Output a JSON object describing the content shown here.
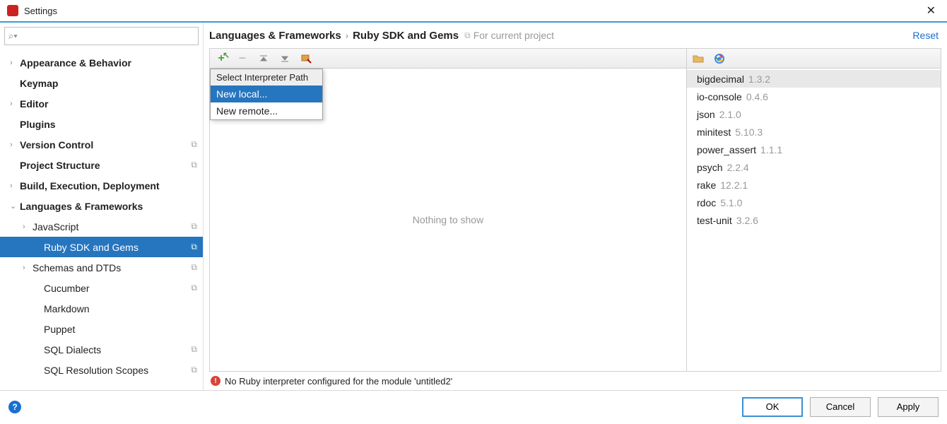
{
  "window": {
    "title": "Settings"
  },
  "sidebar": {
    "search_placeholder": "",
    "items": [
      {
        "label": "Appearance & Behavior",
        "bold": true,
        "arrow": "collapsed",
        "indent": 0
      },
      {
        "label": "Keymap",
        "bold": true,
        "arrow": "",
        "indent": 0
      },
      {
        "label": "Editor",
        "bold": true,
        "arrow": "collapsed",
        "indent": 0
      },
      {
        "label": "Plugins",
        "bold": true,
        "arrow": "",
        "indent": 0
      },
      {
        "label": "Version Control",
        "bold": true,
        "arrow": "collapsed",
        "indent": 0,
        "copy": true
      },
      {
        "label": "Project Structure",
        "bold": true,
        "arrow": "",
        "indent": 0,
        "copy": true
      },
      {
        "label": "Build, Execution, Deployment",
        "bold": true,
        "arrow": "collapsed",
        "indent": 0
      },
      {
        "label": "Languages & Frameworks",
        "bold": true,
        "arrow": "expanded",
        "indent": 0
      },
      {
        "label": "JavaScript",
        "bold": false,
        "arrow": "collapsed",
        "indent": 1,
        "copy": true
      },
      {
        "label": "Ruby SDK and Gems",
        "bold": false,
        "arrow": "",
        "indent": 2,
        "copy": true,
        "selected": true
      },
      {
        "label": "Schemas and DTDs",
        "bold": false,
        "arrow": "collapsed",
        "indent": 1,
        "copy": true
      },
      {
        "label": "Cucumber",
        "bold": false,
        "arrow": "",
        "indent": 2,
        "copy": true
      },
      {
        "label": "Markdown",
        "bold": false,
        "arrow": "",
        "indent": 2
      },
      {
        "label": "Puppet",
        "bold": false,
        "arrow": "",
        "indent": 2
      },
      {
        "label": "SQL Dialects",
        "bold": false,
        "arrow": "",
        "indent": 2,
        "copy": true
      },
      {
        "label": "SQL Resolution Scopes",
        "bold": false,
        "arrow": "",
        "indent": 2,
        "copy": true
      }
    ]
  },
  "breadcrumb": {
    "part1": "Languages & Frameworks",
    "part2": "Ruby SDK and Gems",
    "project_label": "For current project",
    "reset": "Reset"
  },
  "left_panel": {
    "empty": "Nothing to show",
    "popup": {
      "header": "Select Interpreter Path",
      "items": [
        {
          "label": "New local...",
          "hover": true
        },
        {
          "label": "New remote...",
          "hover": false
        }
      ]
    }
  },
  "gems": [
    {
      "name": "bigdecimal",
      "version": "1.3.2",
      "selected": true
    },
    {
      "name": "io-console",
      "version": "0.4.6"
    },
    {
      "name": "json",
      "version": "2.1.0"
    },
    {
      "name": "minitest",
      "version": "5.10.3"
    },
    {
      "name": "power_assert",
      "version": "1.1.1"
    },
    {
      "name": "psych",
      "version": "2.2.4"
    },
    {
      "name": "rake",
      "version": "12.2.1"
    },
    {
      "name": "rdoc",
      "version": "5.1.0"
    },
    {
      "name": "test-unit",
      "version": "3.2.6"
    }
  ],
  "warning": "No Ruby interpreter configured for the module 'untitled2'",
  "footer": {
    "ok": "OK",
    "cancel": "Cancel",
    "apply": "Apply"
  }
}
